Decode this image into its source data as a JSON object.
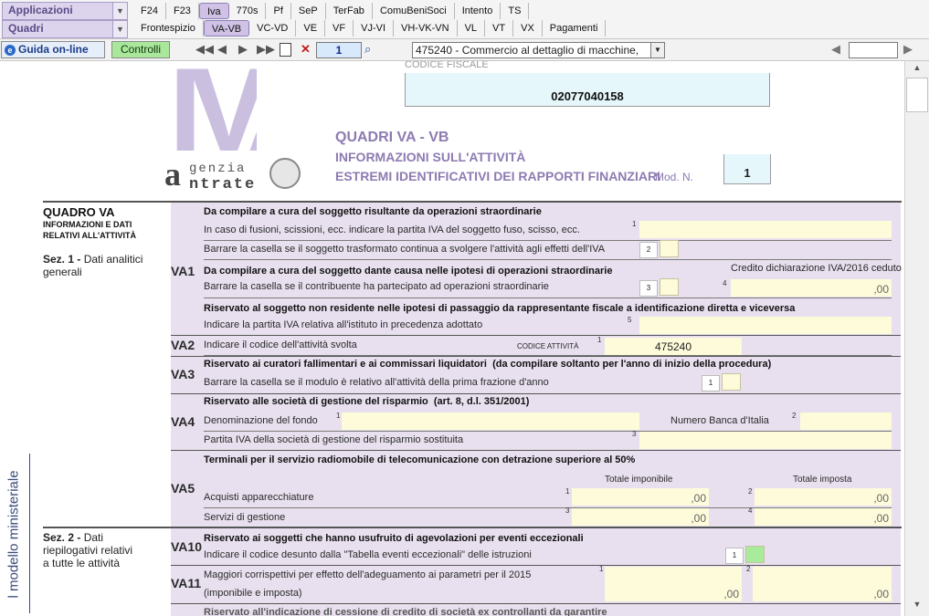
{
  "toolbar": {
    "app_combo": "Applicazioni",
    "quadri_combo": "Quadri",
    "top_tabs": [
      "F24",
      "F23",
      "Iva",
      "770s",
      "Pf",
      "SeP",
      "TerFab",
      "ComuBeniSoci",
      "Intento",
      "TS"
    ],
    "sub_tabs": [
      "Frontespizio",
      "VA-VB",
      "VC-VD",
      "VE",
      "VF",
      "VJ-VI",
      "VH-VK-VN",
      "VL",
      "VT",
      "VX",
      "Pagamenti"
    ]
  },
  "bar2": {
    "guide_label": "Guida on-line",
    "controls_label": "Controlli",
    "page": "1",
    "activity": "475240 - Commercio al dettaglio di macchine,"
  },
  "header": {
    "logo_letters": "IVA",
    "agency_1": "genzia",
    "agency_2": "ntrate",
    "cf_label": "CODICE FISCALE",
    "cf_value": "02077040158",
    "title1": "QUADRI VA - VB",
    "title2": "INFORMAZIONI SULL'ATTIVITÀ",
    "title3": "ESTREMI IDENTIFICATIVI DEI RAPPORTI FINANZIARI",
    "mod_label": "Mod. N.",
    "mod_value": "1"
  },
  "left": {
    "quadro": "QUADRO VA",
    "quadro_sub1": "INFORMAZIONI E DATI",
    "quadro_sub2": "RELATIVI ALL'ATTIVITÀ",
    "sez1_bold": "Sez. 1 -",
    "sez1_rest": "Dati analitici",
    "sez1_line2": "generali",
    "sez2_bold": "Sez. 2 -",
    "sez2_rest": "Dati",
    "sez2_line2": "riepilogativi relativi",
    "sez2_line3": "a tutte le attività",
    "vertical": "l modello ministeriale"
  },
  "va1": {
    "code": "VA1",
    "h1": "Da compilare a cura del soggetto risultante da operazioni straordinarie",
    "l1": "In caso di fusioni, scissioni, ecc. indicare la partita IVA del soggetto fuso, scisso, ecc.",
    "l2": "Barrare la casella se il soggetto trasformato continua a svolgere l'attività agli effetti dell'IVA",
    "h2": "Da compilare a cura del soggetto dante causa nelle ipotesi di operazioni straordinarie",
    "credit": "Credito dichiarazione IVA/2016 ceduto",
    "l3": "Barrare la casella se il contribuente ha partecipato ad operazioni straordinarie",
    "h3": "Riservato al soggetto non residente nelle ipotesi di passaggio da rappresentante fiscale a identificazione diretta e viceversa",
    "l4": "Indicare la partita IVA relativa all'istituto in precedenza adottato",
    "n1": "1",
    "n2": "2",
    "n3": "3",
    "n4": "4",
    "n5": "5",
    "zero": ",00"
  },
  "va2": {
    "code": "VA2",
    "l1": "Indicare il codice dell'attività svolta",
    "label": "CODICE ATTIVITÀ",
    "n": "1",
    "value": "475240"
  },
  "va3": {
    "code": "VA3",
    "h1": "Riservato ai curatori fallimentari e ai commissari liquidatori",
    "h1b": "(da compilare soltanto per l'anno di inizio della procedura)",
    "l1": "Barrare la casella se il modulo è relativo all'attività della prima frazione d'anno",
    "n": "1"
  },
  "va4": {
    "code": "VA4",
    "h1": "Riservato alle società di gestione del risparmio",
    "h1b": "(art. 8, d.l. 351/2001)",
    "l1": "Denominazione del fondo",
    "l1b": "Numero Banca d'Italia",
    "l2": "Partita IVA della società di gestione del risparmio sostituita",
    "n1": "1",
    "n2": "2",
    "n3": "3"
  },
  "va5": {
    "code": "VA5",
    "h1": "Terminali per il servizio radiomobile di telecomunicazione con detrazione superiore al 50%",
    "col1": "Totale imponibile",
    "col2": "Totale imposta",
    "l1": "Acquisti apparecchiature",
    "l2": "Servizi di gestione",
    "n1": "1",
    "n2": "2",
    "n3": "3",
    "n4": "4",
    "zero": ",00"
  },
  "va10": {
    "code": "VA10",
    "h1": "Riservato ai soggetti che hanno usufruito di agevolazioni per eventi eccezionali",
    "l1": "Indicare il codice desunto dalla \"Tabella eventi eccezionali\" delle istruzioni",
    "n": "1"
  },
  "va11": {
    "code": "VA11",
    "l1": "Maggiori corrispettivi per effetto dell'adeguamento ai parametri per il 2015",
    "l2": "(imponibile e imposta)",
    "n1": "1",
    "n2": "2",
    "zero": ",00",
    "cut": "Riservato all'indicazione di cessione di credito di società ex controllanti da garantire"
  },
  "colors": {
    "accent": "#8d7bb2",
    "field": "#fdfbd9",
    "section_bg": "#e8e0ef",
    "active_tab": "#cfc2e6"
  }
}
